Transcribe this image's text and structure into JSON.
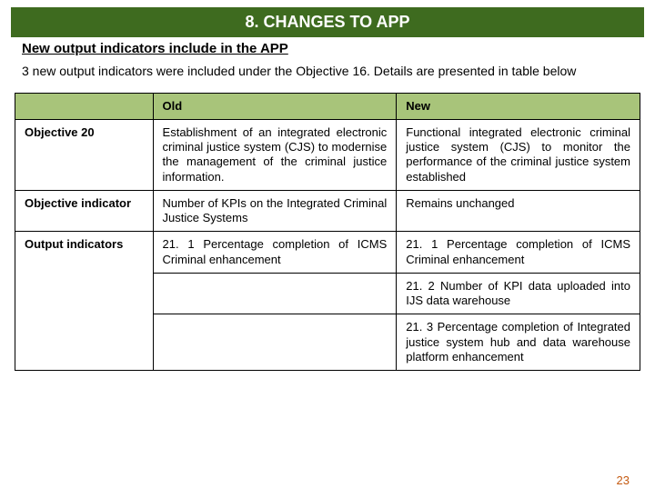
{
  "title": "8. CHANGES TO APP",
  "subtitle": "New  output indicators include in the APP",
  "intro": "3 new  output indicators were included under the Objective 16. Details are presented in table below",
  "headers": {
    "blank": "",
    "old": "Old",
    "new": "New"
  },
  "rows": [
    {
      "label": "Objective 20",
      "old": "Establishment of an integrated electronic criminal justice system (CJS) to modernise the management of the criminal justice information.",
      "new": "Functional integrated electronic criminal justice system (CJS) to monitor the performance of the criminal justice system established"
    },
    {
      "label": "Objective indicator",
      "old": "Number of KPIs on the Integrated Criminal Justice Systems",
      "new": "Remains unchanged"
    },
    {
      "label": "Output indicators",
      "old": "21. 1 Percentage completion of ICMS Criminal enhancement",
      "new": "21. 1 Percentage completion of ICMS Criminal enhancement"
    },
    {
      "label": "",
      "old": "",
      "new": "21. 2 Number of KPI data uploaded into IJS data warehouse"
    },
    {
      "label": "",
      "old": "",
      "new": "21. 3 Percentage completion of Integrated justice system hub and data warehouse platform enhancement"
    }
  ],
  "page_number": "23"
}
